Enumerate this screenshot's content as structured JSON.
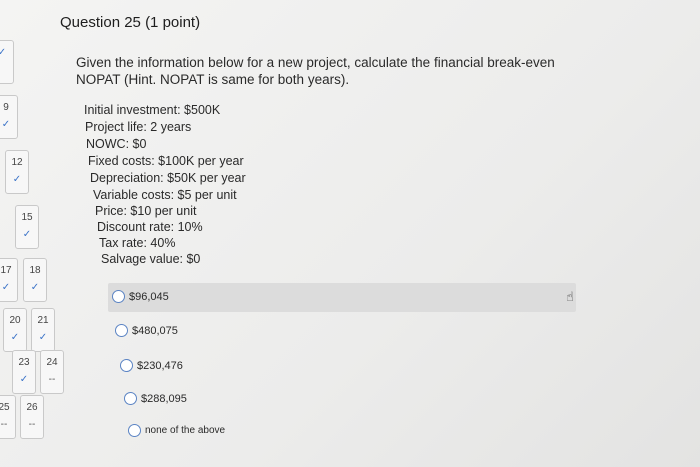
{
  "question": {
    "title_number": "Question 25",
    "title_points": "(1 point)",
    "prompt_line1": "Given the information below for a new project, calculate the financial break-even",
    "prompt_line2": "NOPAT (Hint. NOPAT is same for both years).",
    "info": [
      "Initial investment: $500K",
      "Project life: 2 years",
      "NOWC: $0",
      "Fixed costs: $100K per year",
      "Depreciation: $50K per year",
      "Variable costs: $5 per unit",
      "Price: $10 per unit",
      "Discount rate: 10%",
      "Tax rate: 40%",
      "Salvage value: $0"
    ],
    "options": [
      "$96,045",
      "$480,075",
      "$230,476",
      "$288,095",
      "none of the above"
    ]
  },
  "nav": {
    "items": [
      {
        "num": "",
        "mark": "✓"
      },
      {
        "num": "9",
        "mark": "✓"
      },
      {
        "num": "12",
        "mark": "✓"
      },
      {
        "num": "15",
        "mark": "✓"
      },
      {
        "num": "17",
        "mark": "✓"
      },
      {
        "num": "18",
        "mark": "✓"
      },
      {
        "num": "20",
        "mark": "✓"
      },
      {
        "num": "21",
        "mark": "✓"
      },
      {
        "num": "23",
        "mark": "✓"
      },
      {
        "num": "24",
        "mark": "--"
      },
      {
        "num": "25",
        "mark": "--"
      },
      {
        "num": "26",
        "mark": "--"
      }
    ]
  },
  "icons": {
    "cursor": "hand-pointer-icon"
  }
}
